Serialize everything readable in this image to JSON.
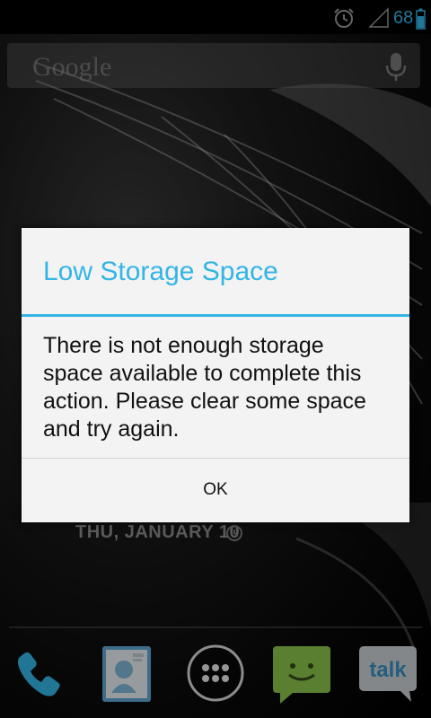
{
  "status_bar": {
    "battery_level": "68",
    "icons": [
      "alarm-icon",
      "signal-icon",
      "battery-icon"
    ],
    "accent": "#33b5e5"
  },
  "search_widget": {
    "logo_text": "Google",
    "icons": [
      "mic-icon"
    ]
  },
  "clock_widget": {
    "date_text": "THU, JANUARY 10",
    "icons": [
      "alarm-clock-icon"
    ]
  },
  "dialog": {
    "title": "Low Storage Space",
    "message": "There is not enough storage space available to complete this action. Please clear some space and try again.",
    "ok_label": "OK",
    "title_color": "#33b5e5"
  },
  "dock": {
    "apps": [
      {
        "name": "phone",
        "icon": "phone-icon"
      },
      {
        "name": "people",
        "icon": "contacts-icon"
      },
      {
        "name": "all-apps",
        "icon": "app-drawer-icon"
      },
      {
        "name": "messaging",
        "icon": "messaging-icon"
      },
      {
        "name": "talk",
        "icon": "talk-icon",
        "label": "talk"
      }
    ]
  }
}
